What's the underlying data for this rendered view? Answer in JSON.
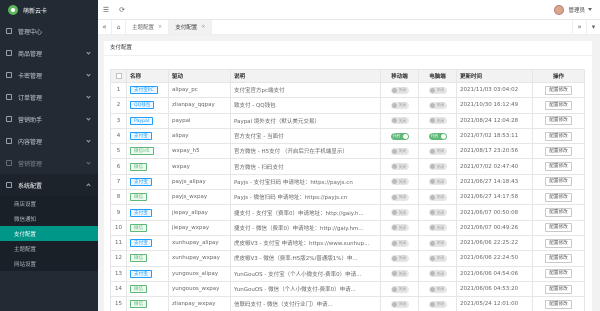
{
  "app": {
    "logo_text": "萌新云卡"
  },
  "sidebar": {
    "items": [
      {
        "label": "管理中心",
        "caret": false
      },
      {
        "label": "商品管理",
        "caret": true
      },
      {
        "label": "卡密管理",
        "caret": true
      },
      {
        "label": "订单管理",
        "caret": true
      },
      {
        "label": "营销助手",
        "caret": true
      },
      {
        "label": "内容管理",
        "caret": true
      },
      {
        "label": "营销管理",
        "caret": true
      }
    ],
    "section": {
      "label": "系统配置"
    },
    "submenu": [
      {
        "label": "商店设置",
        "active": false
      },
      {
        "label": "微信通知",
        "active": false
      },
      {
        "label": "支付配置",
        "active": true
      },
      {
        "label": "主题配置",
        "active": false
      },
      {
        "label": "网站设置",
        "active": false
      }
    ]
  },
  "topbar": {
    "admin_name": "管理员"
  },
  "tabs": [
    {
      "label": "主题配置",
      "active": false
    },
    {
      "label": "支付配置",
      "active": true
    }
  ],
  "card": {
    "title": "支付配置"
  },
  "table": {
    "headers": [
      "",
      "名称",
      "驱动",
      "说明",
      "移动端",
      "电脑端",
      "更新时间",
      "操作"
    ],
    "op_label": "配置修改",
    "rows": [
      {
        "id": "1",
        "name": "支付宝PC",
        "badge": "blue",
        "driver": "alipay_pc",
        "desc": "支付宝官方pc端支付",
        "mobile": false,
        "pc": false,
        "off": "关闭",
        "on": "开启",
        "time": "2021/11/03 03:04:02"
      },
      {
        "id": "2",
        "name": "QQ钱包",
        "badge": "blue",
        "driver": "zlianpay_qqpay",
        "desc": "致支付 - QQ钱包",
        "mobile": false,
        "pc": false,
        "off": "关闭",
        "on": "开启",
        "time": "2021/10/30 16:12:49"
      },
      {
        "id": "3",
        "name": "Paypal",
        "badge": "blue",
        "driver": "paypal",
        "desc": "Paypal 境外支付（默认美元交易）",
        "mobile": false,
        "pc": false,
        "off": "关闭",
        "on": "开启",
        "time": "2021/08/24 12:04:28"
      },
      {
        "id": "4",
        "name": "支付宝",
        "badge": "blue",
        "driver": "alipay",
        "desc": "官方支付宝 - 当面付",
        "mobile": true,
        "pc": true,
        "off": "关闭",
        "on": "开启",
        "time": "2021/07/02 18:53:11"
      },
      {
        "id": "5",
        "name": "微信H5",
        "badge": "green",
        "driver": "wxpay_h5",
        "desc": "官方微信 - H5支付 （开启后只在手机端显示）",
        "mobile": false,
        "pc": false,
        "off": "关闭",
        "on": "开启",
        "time": "2021/08/17 23:20:56"
      },
      {
        "id": "6",
        "name": "微信",
        "badge": "green",
        "driver": "wxpay",
        "desc": "官方微信 - 扫码支付",
        "mobile": false,
        "pc": false,
        "off": "关闭",
        "on": "开启",
        "time": "2021/07/02 02:47:40"
      },
      {
        "id": "7",
        "name": "支付宝",
        "badge": "blue",
        "driver": "payjs_alipay",
        "desc": "Payjs - 支付宝扫码 申请地址：https://payjs.cn",
        "mobile": false,
        "pc": false,
        "off": "关闭",
        "on": "开启",
        "time": "2021/06/27 14:18:43"
      },
      {
        "id": "8",
        "name": "微信",
        "badge": "green",
        "driver": "payjs_wxpay",
        "desc": "Payjs - 微信扫码 申请地址：https://payjs.cn",
        "mobile": false,
        "pc": false,
        "off": "关闭",
        "on": "开启",
        "time": "2021/06/27 14:17:58"
      },
      {
        "id": "9",
        "name": "支付宝",
        "badge": "blue",
        "driver": "jiepay_alipay",
        "desc": "捷支付 - 支付宝（费率0）申请地址：http://gaiy.h...",
        "mobile": false,
        "pc": false,
        "off": "关闭",
        "on": "开启",
        "time": "2021/06/07 00:50:08"
      },
      {
        "id": "10",
        "name": "微信",
        "badge": "green",
        "driver": "jiepay_wxpay",
        "desc": "捷支付 - 微信（费率0）申请地址：http://gaiy.hm...",
        "mobile": false,
        "pc": false,
        "off": "关闭",
        "on": "开启",
        "time": "2021/06/07 00:49:26"
      },
      {
        "id": "11",
        "name": "支付宝",
        "badge": "blue",
        "driver": "xunhupay_alipay",
        "desc": "虎皮椒V3 - 支付宝 申请地址：https://www.xunhup...",
        "mobile": false,
        "pc": false,
        "off": "关闭",
        "on": "开启",
        "time": "2021/06/06 22:25:22"
      },
      {
        "id": "12",
        "name": "微信",
        "badge": "green",
        "driver": "xunhupay_wxpay",
        "desc": "虎皮椒V3 - 微信（费率:H5版2%/普通版1%）申...",
        "mobile": false,
        "pc": false,
        "off": "关闭",
        "on": "开启",
        "time": "2021/06/06 22:24:50"
      },
      {
        "id": "13",
        "name": "支付宝",
        "badge": "blue",
        "driver": "yungouos_alipay",
        "desc": "YunGouOS - 支付宝（个人小微支付-费率0）申请...",
        "mobile": false,
        "pc": false,
        "off": "关闭",
        "on": "开启",
        "time": "2021/06/06 04:54:06"
      },
      {
        "id": "14",
        "name": "微信",
        "badge": "green",
        "driver": "yungouos_wxpay",
        "desc": "YunGouOS - 微信（个人小微支付-费率0）申请...",
        "mobile": false,
        "pc": false,
        "off": "关闭",
        "on": "开启",
        "time": "2021/06/06 04:53:20"
      },
      {
        "id": "15",
        "name": "微信",
        "badge": "green",
        "driver": "zlianpay_wxpay",
        "desc": "信联码支付 - 微信（支付行业门）申请...",
        "mobile": false,
        "pc": false,
        "off": "关闭",
        "on": "开启",
        "time": "2021/05/24 12:01:00"
      }
    ]
  }
}
